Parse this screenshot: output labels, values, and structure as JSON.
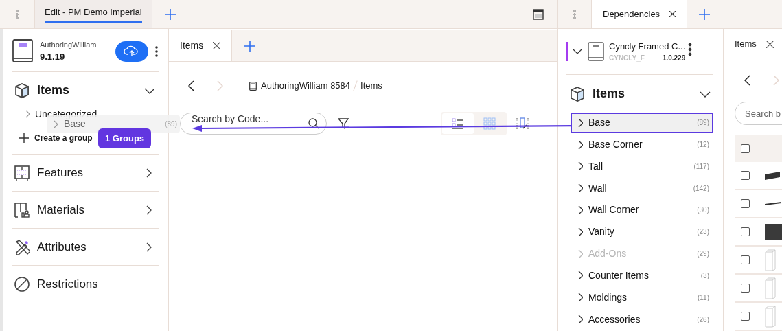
{
  "left_window": {
    "tabs": [
      {
        "label": "Edit - PM Demo Imperial",
        "selected": true
      }
    ],
    "sidebar": {
      "catalog": {
        "name": "AuthoringWilliam",
        "version": "9.1.19"
      },
      "sections": [
        {
          "label": "Items",
          "kind": "tree",
          "expanded": true,
          "children": [
            {
              "label": "Uncategorized"
            }
          ],
          "action": "Create a group"
        },
        {
          "label": "Features",
          "kind": "tree",
          "expanded": false
        },
        {
          "label": "Materials",
          "kind": "tree",
          "expanded": false
        },
        {
          "label": "Attributes",
          "kind": "tree",
          "expanded": false
        },
        {
          "label": "Restrictions",
          "kind": "link"
        }
      ]
    },
    "main": {
      "tabs": [
        {
          "label": "Items",
          "selected": true
        }
      ],
      "breadcrumb": [
        "AuthoringWilliam 8584",
        "Items"
      ],
      "search": {
        "placeholder": "Search by Code..."
      },
      "views": [
        {
          "kind": "list",
          "selected": true
        },
        {
          "kind": "grid",
          "selected": false
        }
      ]
    }
  },
  "drag": {
    "ghost": {
      "label": "Base",
      "count": "(89)"
    },
    "badge": "1 Groups"
  },
  "right_window": {
    "tabs": [
      {
        "label": "Dependencies",
        "selected": true
      }
    ],
    "dependency": {
      "name": "Cyncly Framed C...",
      "code": "CYNCLY_F",
      "version": "1.0.229"
    },
    "section": {
      "label": "Items",
      "expanded": true,
      "categories": [
        {
          "label": "Base",
          "count": "(89)",
          "selected": true,
          "disabled": false
        },
        {
          "label": "Base Corner",
          "count": "(12)",
          "selected": false,
          "disabled": false
        },
        {
          "label": "Tall",
          "count": "(117)",
          "selected": false,
          "disabled": false
        },
        {
          "label": "Wall",
          "count": "(142)",
          "selected": false,
          "disabled": false
        },
        {
          "label": "Wall Corner",
          "count": "(30)",
          "selected": false,
          "disabled": false
        },
        {
          "label": "Vanity",
          "count": "(23)",
          "selected": false,
          "disabled": false
        },
        {
          "label": "Add-Ons",
          "count": "(29)",
          "selected": false,
          "disabled": true
        },
        {
          "label": "Counter Items",
          "count": "(3)",
          "selected": false,
          "disabled": false
        },
        {
          "label": "Moldings",
          "count": "(11)",
          "selected": false,
          "disabled": false
        },
        {
          "label": "Accessories",
          "count": "(26)",
          "selected": false,
          "disabled": false
        }
      ]
    },
    "panel": {
      "tabs": [
        {
          "label": "Items",
          "selected": true
        }
      ],
      "search": {
        "placeholder": "Search b"
      },
      "header_checked": false,
      "rows": [
        {
          "checked": false
        },
        {
          "checked": false
        },
        {
          "checked": false
        },
        {
          "checked": false
        },
        {
          "checked": false
        },
        {
          "checked": false
        }
      ]
    }
  }
}
